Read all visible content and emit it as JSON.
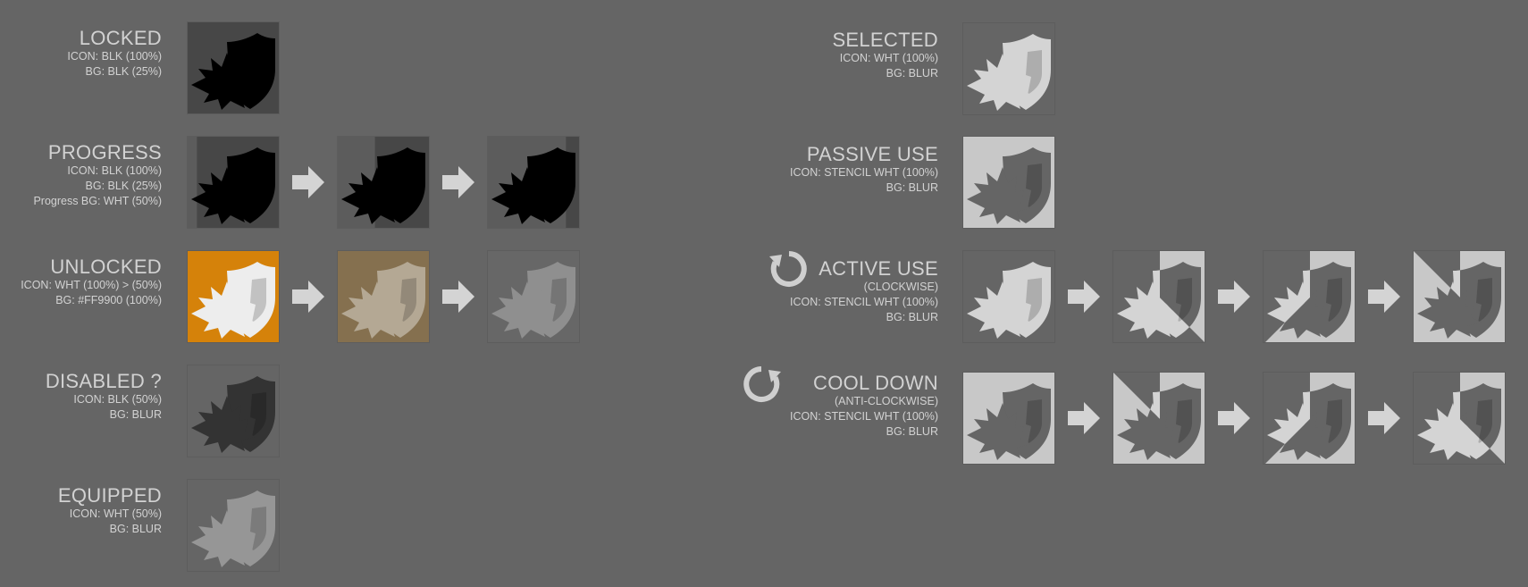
{
  "colors": {
    "background": "#656565",
    "text": "#d2d2d2",
    "orange": "#FF9900",
    "dark_tile": "#474747",
    "light_tile": "#c7c7c7",
    "arrow": "#d4d4d4"
  },
  "states": {
    "locked": {
      "title": "LOCKED",
      "lines": [
        "ICON: BLK (100%)",
        "BG: BLK (25%)"
      ]
    },
    "progress": {
      "title": "PROGRESS",
      "lines": [
        "ICON: BLK (100%)",
        "BG: BLK (25%)",
        "Progress BG: WHT (50%)"
      ]
    },
    "unlocked": {
      "title": "UNLOCKED",
      "lines": [
        "ICON: WHT (100%) > (50%)",
        "BG: #FF9900 (100%)"
      ]
    },
    "disabled": {
      "title": "DISABLED ?",
      "lines": [
        "ICON: BLK (50%)",
        "BG: BLUR"
      ]
    },
    "equipped": {
      "title": "EQUIPPED",
      "lines": [
        "ICON: WHT (50%)",
        "BG: BLUR"
      ]
    },
    "selected": {
      "title": "SELECTED",
      "lines": [
        "ICON: WHT (100%)",
        "BG: BLUR"
      ]
    },
    "passive_use": {
      "title": "PASSIVE USE",
      "lines": [
        "ICON: STENCIL WHT (100%)",
        "BG: BLUR"
      ]
    },
    "active_use": {
      "title": "ACTIVE USE",
      "lines": [
        "(CLOCKWISE)",
        "ICON: STENCIL WHT (100%)",
        "BG: BLUR"
      ]
    },
    "cool_down": {
      "title": "COOL DOWN",
      "lines": [
        "(ANTI-CLOCKWISE)",
        "ICON: STENCIL WHT (100%)",
        "BG: BLUR"
      ]
    }
  },
  "icons": {
    "ability": "explosion-shield-icon",
    "arrow": "arrow-right-icon",
    "clockwise": "rotate-clockwise-icon",
    "anticlockwise": "rotate-anticlockwise-icon"
  }
}
